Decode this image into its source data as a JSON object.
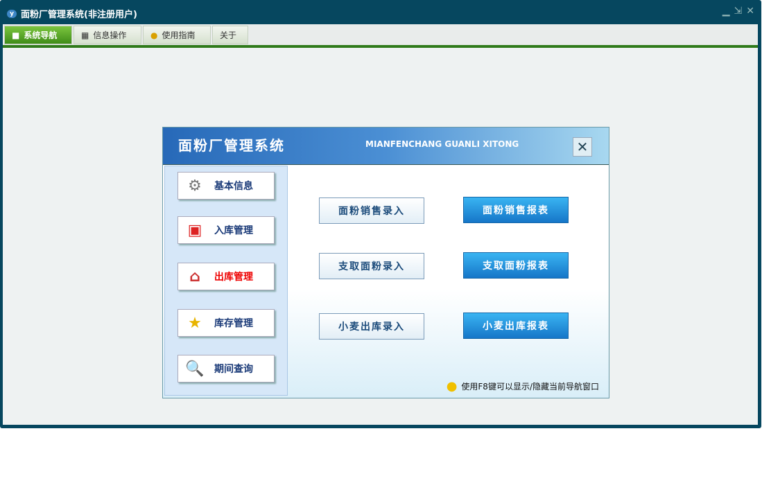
{
  "window": {
    "title": "面粉厂管理系统(非注册用户)"
  },
  "tabs": [
    "系统导航",
    "信息操作",
    "使用指南",
    "关于"
  ],
  "panel": {
    "title": "面粉厂管理系统",
    "subtitle": "MIANFENCHANG GUANLI XITONG",
    "side": [
      "基本信息",
      "入库管理",
      "出库管理",
      "库存管理",
      "期间查询"
    ],
    "entry": [
      "面粉销售录入",
      "支取面粉录入",
      "小麦出库录入"
    ],
    "report": [
      "面粉销售报表",
      "支取面粉报表",
      "小麦出库报表"
    ],
    "tip": "使用F8键可以显示/隐藏当前导航窗口"
  }
}
